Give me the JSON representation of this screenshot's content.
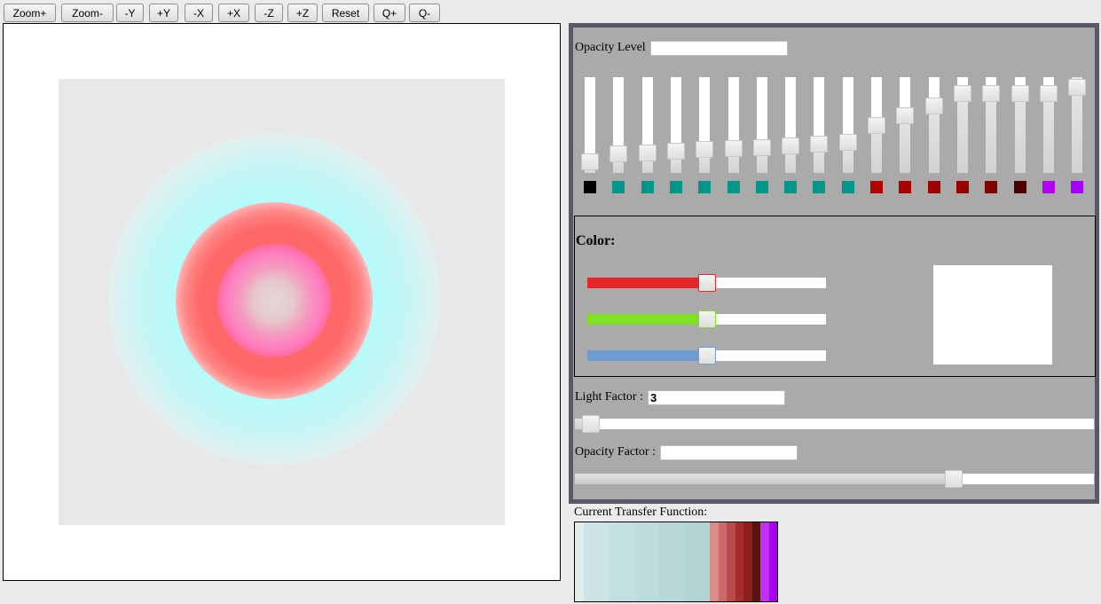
{
  "toolbar": {
    "buttons": [
      "Zoom+",
      "Zoom-",
      "-Y",
      "+Y",
      "-X",
      "+X",
      "-Z",
      "+Z",
      "Reset",
      "Q+",
      "Q-"
    ]
  },
  "panel": {
    "opacity_level_label": "Opacity Level",
    "opacity_level_value": "",
    "sliders": [
      {
        "level": 0.06,
        "color": "#000000"
      },
      {
        "level": 0.16,
        "color": "#00968a"
      },
      {
        "level": 0.17,
        "color": "#00968a"
      },
      {
        "level": 0.19,
        "color": "#00968a"
      },
      {
        "level": 0.21,
        "color": "#00968a"
      },
      {
        "level": 0.22,
        "color": "#00968a"
      },
      {
        "level": 0.24,
        "color": "#00968a"
      },
      {
        "level": 0.26,
        "color": "#00968a"
      },
      {
        "level": 0.28,
        "color": "#00968a"
      },
      {
        "level": 0.3,
        "color": "#00968a"
      },
      {
        "level": 0.52,
        "color": "#b20000"
      },
      {
        "level": 0.64,
        "color": "#a80000"
      },
      {
        "level": 0.76,
        "color": "#a00000"
      },
      {
        "level": 0.92,
        "color": "#980000"
      },
      {
        "level": 0.92,
        "color": "#800000"
      },
      {
        "level": 0.92,
        "color": "#4a0000"
      },
      {
        "level": 0.92,
        "color": "#b000f0"
      },
      {
        "level": 1.0,
        "color": "#a400ff"
      }
    ],
    "color_heading": "Color:",
    "rgb_sliders": [
      {
        "name": "red",
        "level": 0.5,
        "color": "#e8262a"
      },
      {
        "name": "green",
        "level": 0.5,
        "color": "#7de022"
      },
      {
        "name": "blue",
        "level": 0.5,
        "color": "#6f9dd1"
      }
    ],
    "preview_color": "#ffffff",
    "light_factor_label": "Light Factor :",
    "light_factor_value": "3",
    "light_factor_level": 0.03,
    "opacity_factor_label": "Opacity Factor :",
    "opacity_factor_value": "",
    "opacity_factor_level": 0.73
  },
  "transfer_function": {
    "label": "Current Transfer Function:",
    "bands": [
      {
        "color": "#e2ecec",
        "weight": 1
      },
      {
        "color": "#cde4e4",
        "weight": 3
      },
      {
        "color": "#c4dfdf",
        "weight": 3
      },
      {
        "color": "#bfdcdc",
        "weight": 3
      },
      {
        "color": "#b8d8d8",
        "weight": 3
      },
      {
        "color": "#b2d4d4",
        "weight": 3
      },
      {
        "color": "#d88c8c",
        "weight": 1
      },
      {
        "color": "#ca6a6a",
        "weight": 1
      },
      {
        "color": "#bb4a4a",
        "weight": 1
      },
      {
        "color": "#a82c2c",
        "weight": 1
      },
      {
        "color": "#8c2020",
        "weight": 1
      },
      {
        "color": "#5a1414",
        "weight": 1
      },
      {
        "color": "#c030f8",
        "weight": 1
      },
      {
        "color": "#a800ee",
        "weight": 1
      }
    ]
  }
}
